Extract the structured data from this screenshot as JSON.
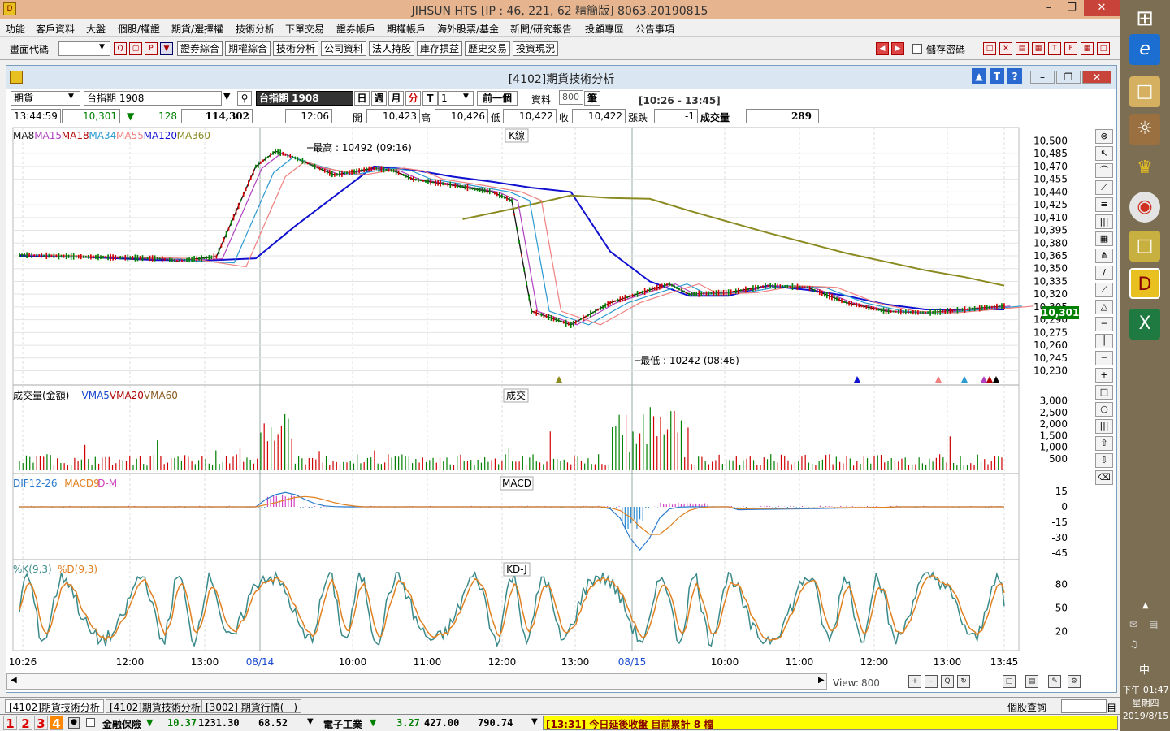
{
  "app": {
    "title": "JIHSUN HTS      [IP : 46, 221, 62 精簡版] 8063.20190815"
  },
  "menu": [
    "功能",
    "客戶資料",
    "大盤",
    "個股/權證",
    "期貨/選擇權",
    "技術分析",
    "下單交易",
    "證券帳戶",
    "期權帳戶",
    "海外股票/基金",
    "新聞/研究報告",
    "投顧專區",
    "公告事項"
  ],
  "toolbar": {
    "code_label": "畫面代碼",
    "code_value": "",
    "buttons": [
      "證券綜合",
      "期權綜合",
      "技術分析",
      "公司資料",
      "法人持股",
      "庫存損益",
      "歷史交易",
      "投資現況"
    ],
    "save_pwd": "儲存密碼"
  },
  "window": {
    "title": "[4102]期貨技術分析",
    "type": "期貨",
    "symbol": "台指期 1908",
    "symbol_dark": "台指期 1908",
    "periods": [
      "日",
      "週",
      "月",
      "分",
      "T"
    ],
    "active_period": "分",
    "interval": "1",
    "prev_btn": "前一個",
    "data_label": "資料",
    "data_count": "800",
    "data_unit": "筆",
    "range": "[10:26 - 13:45]",
    "time": "13:44:59",
    "price": "10,301",
    "change": "128",
    "volume_total": "114,302",
    "t2": "12:06",
    "open_val": "10,423",
    "open_lbl": "開",
    "high_val": "10,426",
    "high_lbl": "高",
    "low_val": "10,422",
    "low_lbl": "低",
    "close_val": "10,422",
    "close_lbl": "收",
    "chg_lbl": "漲跌",
    "chg_val": "-1",
    "vol_lbl": "成交量",
    "vol_val": "289"
  },
  "colors": {
    "ma8": "#1a1a1a",
    "ma15": "#b040c0",
    "ma18": "#b00000",
    "ma34": "#2a9ad0",
    "ma55": "#f08080",
    "ma120": "#1010d0",
    "ma360": "#8a8a20",
    "up": "#d00000",
    "down": "#008000"
  },
  "chart_data": [
    {
      "type": "line",
      "title": "K線",
      "legend": [
        "MA8",
        "MA15",
        "MA18",
        "MA34",
        "MA55",
        "MA120",
        "MA360"
      ],
      "yticks": [
        10500,
        10485,
        10470,
        10455,
        10440,
        10425,
        10410,
        10395,
        10380,
        10365,
        10350,
        10335,
        10320,
        10305,
        10290,
        10275,
        10260,
        10245,
        10230
      ],
      "ylim": [
        10220,
        10510
      ],
      "last_price": "10,301",
      "annotations": [
        "最高 : 10492 (09:16)",
        "最低 : 10242 (08:46)"
      ],
      "series": [
        {
          "name": "MA8",
          "x": [
            0,
            6,
            14,
            16,
            20,
            24,
            26,
            28,
            32,
            36,
            38,
            40,
            44,
            48,
            50,
            52,
            56,
            60,
            64,
            66,
            68,
            72,
            76,
            80,
            84,
            88,
            92,
            96,
            100
          ],
          "values": [
            10366,
            10364,
            10362,
            10359,
            10364,
            10470,
            10488,
            10480,
            10460,
            10468,
            10465,
            10455,
            10448,
            10440,
            10430,
            10300,
            10284,
            10310,
            10325,
            10332,
            10320,
            10322,
            10330,
            10328,
            10310,
            10300,
            10298,
            10302,
            10306
          ]
        },
        {
          "name": "MA120",
          "x": [
            0,
            6,
            14,
            20,
            24,
            28,
            36,
            40,
            44,
            48,
            52,
            56,
            60,
            64,
            68,
            72,
            76,
            80,
            84,
            88,
            92,
            96,
            100
          ],
          "values": [
            10365,
            10364,
            10360,
            10360,
            10362,
            10400,
            10470,
            10466,
            10458,
            10452,
            10445,
            10440,
            10370,
            10335,
            10318,
            10318,
            10330,
            10325,
            10318,
            10308,
            10302,
            10302,
            10302
          ]
        },
        {
          "name": "MA360",
          "x": [
            45,
            50,
            56,
            60,
            64,
            68,
            72,
            76,
            80,
            84,
            88,
            92,
            96,
            100
          ],
          "values": [
            10408,
            10420,
            10436,
            10433,
            10432,
            10418,
            10405,
            10392,
            10380,
            10368,
            10358,
            10348,
            10340,
            10330
          ]
        }
      ]
    },
    {
      "type": "bar",
      "title": "成交",
      "legend": [
        "成交量(金額)",
        "VMA5",
        "VMA20",
        "VMA60"
      ],
      "yticks": [
        3000,
        2500,
        2000,
        1500,
        1000,
        500
      ]
    },
    {
      "type": "bar",
      "title": "MACD",
      "legend": [
        "DIF12-26",
        "MACD9",
        "D-M"
      ],
      "yticks": [
        15,
        0,
        -15,
        -30,
        -45
      ]
    },
    {
      "type": "line",
      "title": "KD-J",
      "legend": [
        "%K(9,3)",
        "%D(9,3)"
      ],
      "yticks": [
        80,
        50,
        20
      ]
    }
  ],
  "xaxis": [
    "10:26",
    "12:00",
    "13:00",
    "08/14",
    "10:00",
    "11:00",
    "12:00",
    "13:00",
    "08/15",
    "10:00",
    "11:00",
    "12:00",
    "13:00",
    "13:45"
  ],
  "view": {
    "label": "View:",
    "value": "800"
  },
  "tabs": [
    "[4102]期貨技術分析",
    "[4102]期貨技術分析",
    "[3002] 期貨行情(一)"
  ],
  "status": {
    "stock_query": "個股查詢",
    "s1_name": "金融保險",
    "s1_chg": "10.37",
    "s1_idx": "1231.30",
    "s1_vol": "68.52",
    "s2_name": "電子工業",
    "s2_chg": "3.27",
    "s2_idx": "427.00",
    "s2_vol": "790.74",
    "ticker": "[13:31] 今日延後收盤 目前累計 8 檔",
    "nums": [
      "1",
      "2",
      "3",
      "4"
    ],
    "self": "自"
  },
  "taskbar": {
    "time": "下午 01:47",
    "weekday": "星期四",
    "date": "2019/8/15",
    "ime": "中"
  }
}
